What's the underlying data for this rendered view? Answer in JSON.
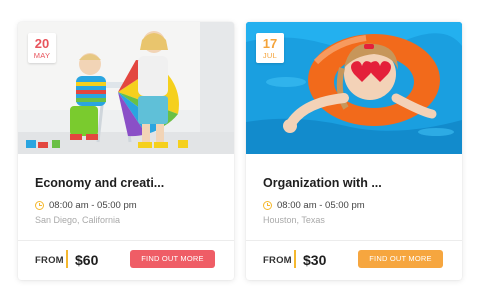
{
  "colors": {
    "accent_red": "#ef5d66",
    "accent_orange": "#f6a63f",
    "clock_yellow": "#f5b82e"
  },
  "events": [
    {
      "day": "20",
      "month": "MAY",
      "title": "Economy and creati...",
      "time": "08:00 am - 05:00 pm",
      "location": "San Diego, California",
      "from_label": "FROM",
      "price": "$60",
      "cta_label": "FIND OUT MORE",
      "image": "kids-playing-with-color-fan-photo"
    },
    {
      "day": "17",
      "month": "JUL",
      "title": "Organization with ...",
      "time": "08:00 am - 05:00 pm",
      "location": "Houston, Texas",
      "from_label": "FROM",
      "price": "$30",
      "cta_label": "FIND OUT MORE",
      "image": "girl-in-swim-ring-photo"
    }
  ]
}
